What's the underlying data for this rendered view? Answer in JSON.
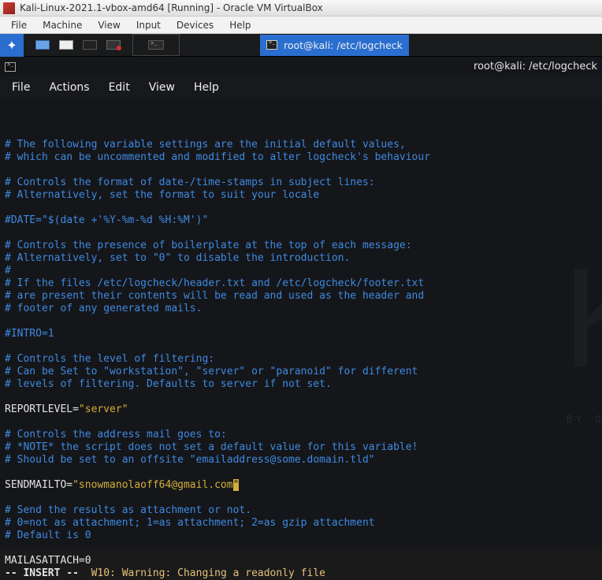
{
  "vbox": {
    "title": "Kali-Linux-2021.1-vbox-amd64 [Running] - Oracle VM VirtualBox",
    "menu": [
      "File",
      "Machine",
      "View",
      "Input",
      "Devices",
      "Help"
    ]
  },
  "panel": {
    "active_window": "root@kali: /etc/logcheck"
  },
  "terminal": {
    "title": "root@kali: /etc/logcheck",
    "menu": [
      "File",
      "Actions",
      "Edit",
      "View",
      "Help"
    ]
  },
  "file": {
    "lines": [
      {
        "t": "cmt",
        "v": "# The following variable settings are the initial default values,"
      },
      {
        "t": "cmt",
        "v": "# which can be uncommented and modified to alter logcheck's behaviour"
      },
      {
        "t": "blank",
        "v": ""
      },
      {
        "t": "cmt",
        "v": "# Controls the format of date-/time-stamps in subject lines:"
      },
      {
        "t": "cmt",
        "v": "# Alternatively, set the format to suit your locale"
      },
      {
        "t": "blank",
        "v": ""
      },
      {
        "t": "cmt",
        "v": "#DATE=\"$(date +'%Y-%m-%d %H:%M')\""
      },
      {
        "t": "blank",
        "v": ""
      },
      {
        "t": "cmt",
        "v": "# Controls the presence of boilerplate at the top of each message:"
      },
      {
        "t": "cmt",
        "v": "# Alternatively, set to \"0\" to disable the introduction."
      },
      {
        "t": "cmt",
        "v": "#"
      },
      {
        "t": "cmt",
        "v": "# If the files /etc/logcheck/header.txt and /etc/logcheck/footer.txt"
      },
      {
        "t": "cmt",
        "v": "# are present their contents will be read and used as the header and"
      },
      {
        "t": "cmt",
        "v": "# footer of any generated mails."
      },
      {
        "t": "blank",
        "v": ""
      },
      {
        "t": "cmt",
        "v": "#INTRO=1"
      },
      {
        "t": "blank",
        "v": ""
      },
      {
        "t": "cmt",
        "v": "# Controls the level of filtering:"
      },
      {
        "t": "cmt",
        "v": "# Can be Set to \"workstation\", \"server\" or \"paranoid\" for different"
      },
      {
        "t": "cmt",
        "v": "# levels of filtering. Defaults to server if not set."
      },
      {
        "t": "blank",
        "v": ""
      },
      {
        "t": "assign",
        "key": "REPORTLEVEL=",
        "val": "\"server\""
      },
      {
        "t": "blank",
        "v": ""
      },
      {
        "t": "cmt",
        "v": "# Controls the address mail goes to:"
      },
      {
        "t": "cmt",
        "v": "# *NOTE* the script does not set a default value for this variable!"
      },
      {
        "t": "cmt",
        "v": "# Should be set to an offsite \"emailaddress@some.domain.tld\""
      },
      {
        "t": "blank",
        "v": ""
      },
      {
        "t": "assign_cursor",
        "key": "SENDMAILTO=",
        "val": "\"snowmanolaoff64@gmail.com",
        "cursor": "\""
      },
      {
        "t": "blank",
        "v": ""
      },
      {
        "t": "cmt",
        "v": "# Send the results as attachment or not."
      },
      {
        "t": "cmt",
        "v": "# 0=not as attachment; 1=as attachment; 2=as gzip attachment"
      },
      {
        "t": "cmt",
        "v": "# Default is 0"
      },
      {
        "t": "blank",
        "v": ""
      },
      {
        "t": "plain",
        "v": "MAILASATTACH=0"
      }
    ],
    "status_mode": "-- INSERT --",
    "status_warn": "W10: Warning: Changing a readonly file"
  }
}
